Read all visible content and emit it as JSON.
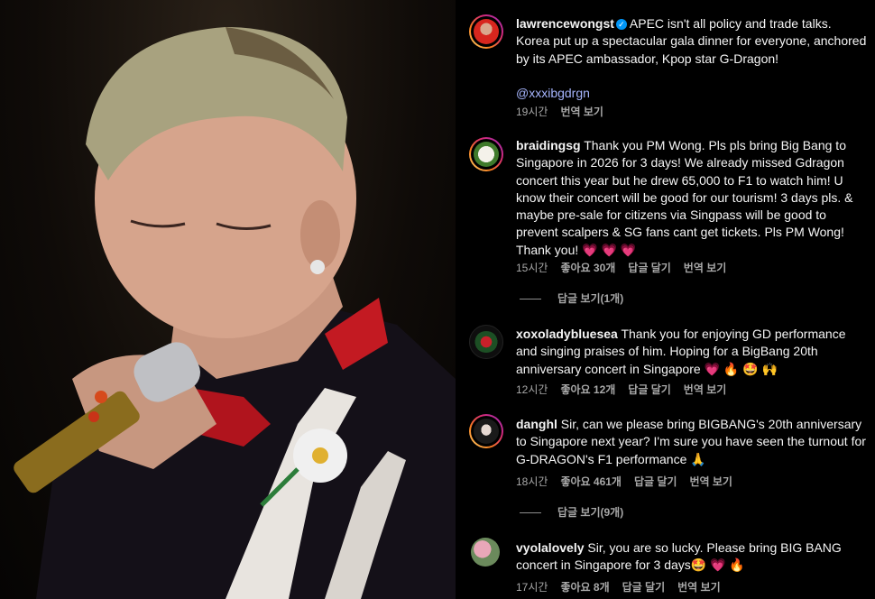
{
  "post": {
    "username": "lawrencewongst",
    "verified": true,
    "caption": "APEC isn't all policy and trade talks. Korea put up a spectacular gala dinner for everyone, anchored by its APEC ambassador, Kpop star G-Dragon!",
    "mention": "@xxxibgdrgn",
    "time": "19시간",
    "translate": "번역 보기"
  },
  "comments": [
    {
      "username": "braidingsg",
      "text": "Thank you PM Wong. Pls pls bring Big Bang to Singapore in 2026 for 3 days! We already missed Gdragon concert this year but he drew 65,000 to F1 to watch him! U know their concert will be good for our tourism! 3 days pls. & maybe pre-sale for citizens via Singpass will be good to prevent scalpers & SG fans cant get tickets. Pls PM Wong! Thank you! 💗 💗 💗",
      "time": "15시간",
      "likes": "좋아요 30개",
      "reply": "답글 달기",
      "translate": "번역 보기",
      "view_replies": "답글 보기(1개)"
    },
    {
      "username": "xoxoladybluesea",
      "text": "Thank you for enjoying GD performance and singing praises of him. Hoping for a BigBang 20th anniversary concert in Singapore 💗 🔥 🤩 🙌",
      "time": "12시간",
      "likes": "좋아요 12개",
      "reply": "답글 달기",
      "translate": "번역 보기"
    },
    {
      "username": "danghl",
      "text": "Sir, can we please bring BIGBANG's 20th anniversary to Singapore next year? I'm sure you have seen the turnout for G-DRAGON's F1 performance 🙏",
      "time": "18시간",
      "likes": "좋아요 461개",
      "reply": "답글 달기",
      "translate": "번역 보기",
      "view_replies": "답글 보기(9개)"
    },
    {
      "username": "vyolalovely",
      "text": "Sir, you are so lucky. Please bring BIG BANG concert in Singapore for 3 days🤩 💗 🔥",
      "time": "17시간",
      "likes": "좋아요 8개",
      "reply": "답글 달기",
      "translate": "번역 보기"
    }
  ],
  "colors": {
    "background": "#000000",
    "text": "#f5f5f5",
    "meta": "#a8a8a8",
    "mention": "#a5b4fc",
    "verified": "#0095f6"
  },
  "icons": {
    "verified": "verified-badge-icon"
  }
}
